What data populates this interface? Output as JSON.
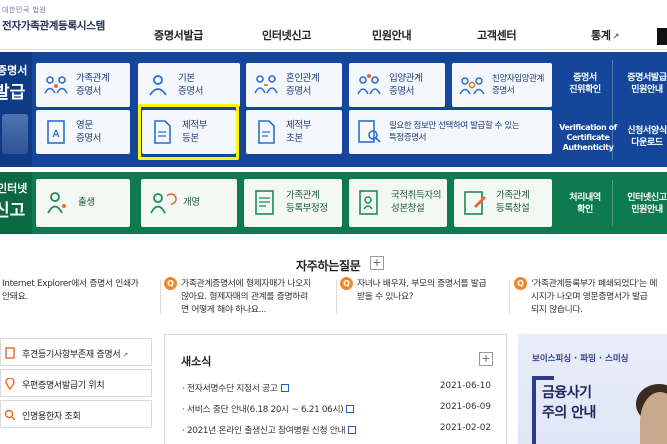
{
  "header": {
    "logo_small": "대한민국 법원",
    "logo_main": "전자가족관계등록시스템",
    "nav": [
      {
        "label": "증명서발급",
        "ext": false
      },
      {
        "label": "인터넷신고",
        "ext": false
      },
      {
        "label": "민원안내",
        "ext": false
      },
      {
        "label": "고객센터",
        "ext": false
      },
      {
        "label": "통계",
        "ext": true
      }
    ],
    "ext_glyph": "↗"
  },
  "cert": {
    "label_line1": "증명서",
    "label_line2": "발급",
    "tiles": [
      {
        "line1": "가족관계",
        "line2": "증명서",
        "icon": "family-icon"
      },
      {
        "line1": "기본",
        "line2": "증명서",
        "icon": "person-icon"
      },
      {
        "line1": "혼인관계",
        "line2": "증명서",
        "icon": "couple-icon"
      },
      {
        "line1": "입양관계",
        "line2": "증명서",
        "icon": "adoption-icon"
      },
      {
        "line1": "친양자입양관계",
        "line2": "증명서",
        "icon": "group-icon"
      },
      {
        "line1": "영문",
        "line2": "증명서",
        "icon": "english-doc-icon"
      },
      {
        "line1": "제적부",
        "line2": "등본",
        "icon": "removed-register-copy-icon"
      },
      {
        "line1": "제적부",
        "line2": "초본",
        "icon": "removed-register-abstract-icon"
      },
      {
        "line1": "필요한 정보만 선택하여 발급할 수 있는",
        "line2": "특정증명서",
        "icon": "magnifier-doc-icon"
      }
    ],
    "side": [
      {
        "line1": "증명서",
        "line2": "진위확인"
      },
      {
        "line1": "증명서발급",
        "line2": "민원안내"
      },
      {
        "line1": "Verification of",
        "line2": "Certificate",
        "line3": "Authenticity"
      },
      {
        "line1": "신청서양식",
        "line2": "다운로드"
      }
    ]
  },
  "report": {
    "label_line1": "인터넷",
    "label_line2": "신고",
    "tiles": [
      {
        "line1": "출생",
        "line2": "",
        "icon": "baby-icon"
      },
      {
        "line1": "개명",
        "line2": "",
        "icon": "rename-icon"
      },
      {
        "line1": "가족관계",
        "line2": "등록부정정",
        "icon": "correction-doc-icon"
      },
      {
        "line1": "국적취득자의",
        "line2": "성본창설",
        "icon": "nationality-icon"
      },
      {
        "line1": "가족관계",
        "line2": "등록창설",
        "icon": "create-doc-icon"
      }
    ],
    "side": [
      {
        "line1": "처리내역",
        "line2": "확인"
      },
      {
        "line1": "인터넷신고",
        "line2": "민원안내"
      }
    ]
  },
  "faq": {
    "title": "자주하는질문",
    "plus": "+",
    "items": [
      {
        "line1": "Internet Explorer에서 증명서 인쇄가",
        "line2": "안돼요.",
        "line3": ""
      },
      {
        "line1": "가족관계증명서에 형제자매가 나오지",
        "line2": "않아요. 형제자매의 관계를 증명하려",
        "line3": "면 어떻게 해야 하나요..."
      },
      {
        "line1": "자녀나 배우자, 부모의 증명서를 발급",
        "line2": "받을 수 있나요?",
        "line3": ""
      },
      {
        "line1": "'가족관계등록부가 폐쇄되었다'는 메",
        "line2": "시지가 나오며 영문증명서가 발급",
        "line3": "되지 않습니다."
      }
    ],
    "q_glyph": "Q"
  },
  "links": [
    {
      "label": "후견등기사항부존재 증명서",
      "ext": true
    },
    {
      "label": "우편증명서발급기 위치",
      "ext": false
    },
    {
      "label": "인명용한자 조회",
      "ext": false
    }
  ],
  "news": {
    "title": "새소식",
    "plus": "+",
    "items": [
      {
        "label": "· 전자서명수단 지정서 공고",
        "date": "2021-06-10",
        "doc": true
      },
      {
        "label": "· 서비스 중단 안내(6.18 20시 ~ 6.21 06시)",
        "date": "2021-06-09",
        "doc": true
      },
      {
        "label": "· 2021년 온라인 출생신고 참여병원 신청 안내",
        "date": "2021-02-02",
        "doc": true
      }
    ]
  },
  "banner": {
    "top": "보이스피싱 · 파밍 · 스미싱",
    "line1": "금융사기",
    "line2": "주의 안내"
  },
  "colors": {
    "cert_band": "#14469b",
    "report_band": "#0d7a4f",
    "highlight": "#fff600",
    "faq_badge": "#f0882a"
  }
}
